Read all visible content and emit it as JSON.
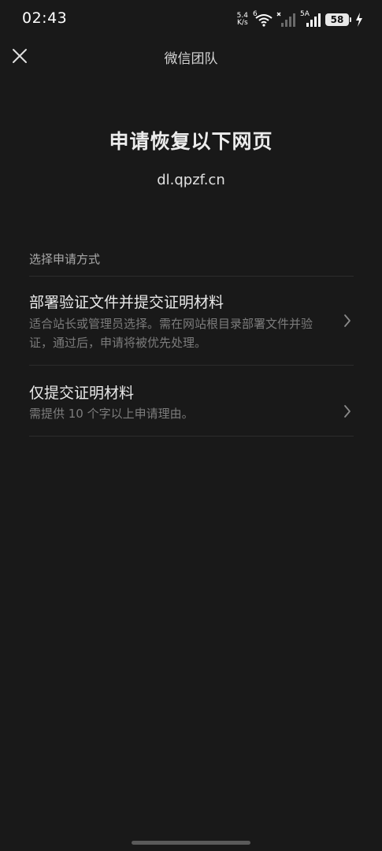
{
  "status_bar": {
    "time": "02:43",
    "net_speed_value": "5.4",
    "net_speed_unit": "K/s",
    "wifi_label": "6",
    "signal_label": "5A",
    "battery": "58",
    "icons": [
      "wifi-icon",
      "signal-off-icon",
      "signal-icon",
      "battery-icon",
      "charging-icon"
    ]
  },
  "nav": {
    "title": "微信团队",
    "close_icon": "close-icon"
  },
  "header": {
    "title": "申请恢复以下网页",
    "domain": "dl.qpzf.cn"
  },
  "section": {
    "label": "选择申请方式",
    "options": [
      {
        "title": "部署验证文件并提交证明材料",
        "description": "适合站长或管理员选择。需在网站根目录部署文件并验证，通过后，申请将被优先处理。"
      },
      {
        "title": "仅提交证明材料",
        "description": "需提供 10 个字以上申请理由。"
      }
    ]
  },
  "colors": {
    "background": "#191919",
    "text_primary": "#e9e9e9",
    "text_secondary": "#7c7c7c",
    "divider": "#2c2c2c"
  }
}
